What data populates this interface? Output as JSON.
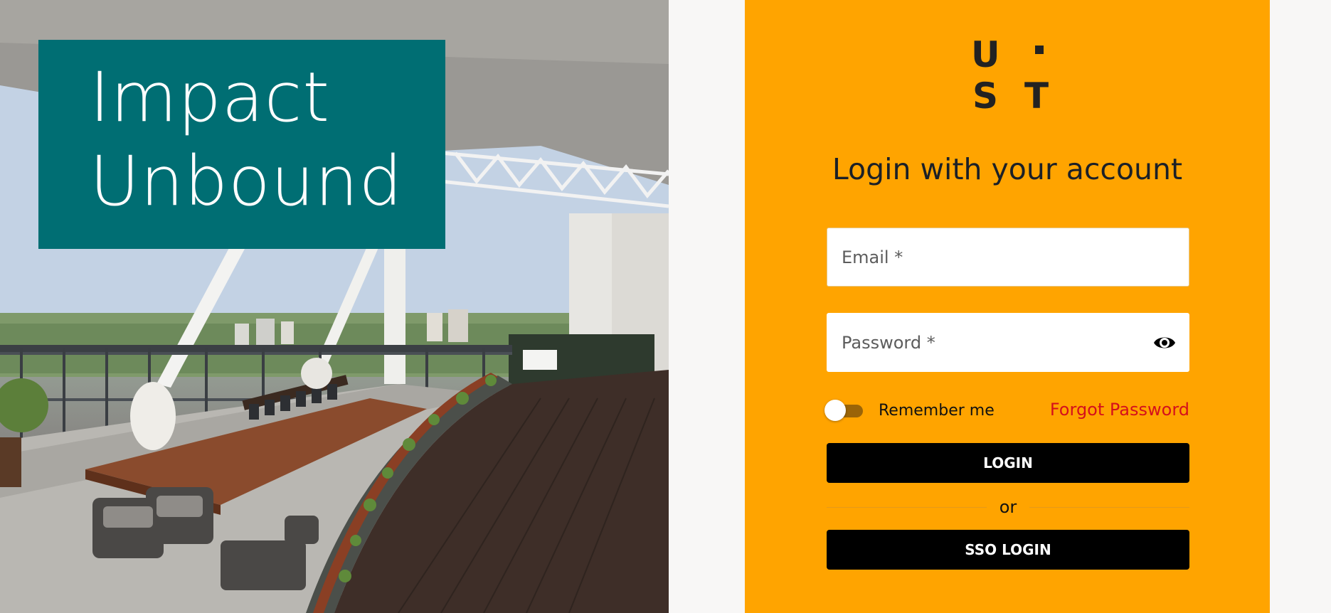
{
  "hero": {
    "tagline_line1": "Impact",
    "tagline_line2": "Unbound",
    "box_color": "#006e73"
  },
  "login": {
    "logo_row1_left": "U",
    "logo_row2_left": "S",
    "logo_row2_right": "T",
    "heading": "Login with your account",
    "email_placeholder": "Email *",
    "password_placeholder": "Password *",
    "remember_label": "Remember me",
    "remember_on": false,
    "forgot_label": "Forgot Password",
    "login_button": "LOGIN",
    "divider_label": "or",
    "sso_button": "SSO LOGIN",
    "panel_color": "#ffa400",
    "forgot_color": "#d4101c"
  },
  "icons": {
    "password_toggle": "eye-icon"
  }
}
